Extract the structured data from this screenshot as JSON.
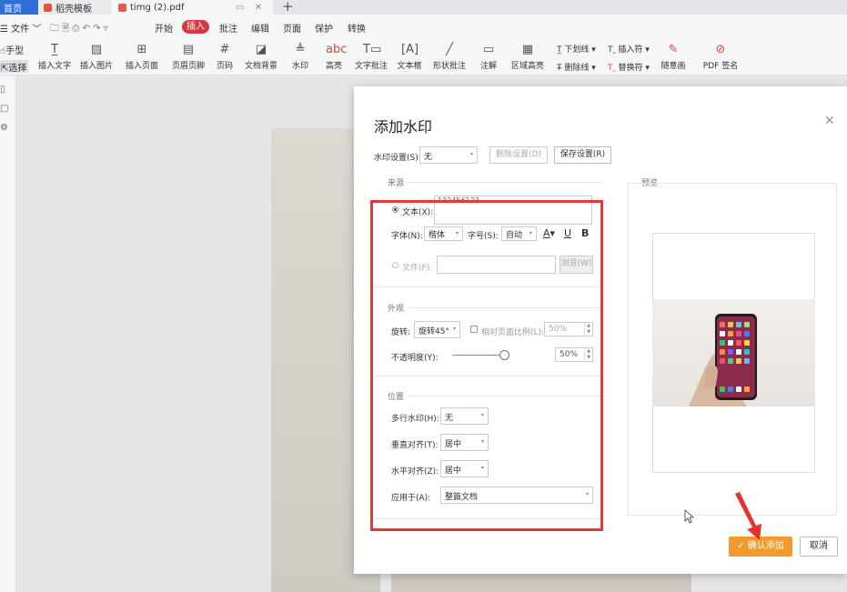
{
  "tabs": [
    {
      "label": "首页"
    },
    {
      "label": "稻壳模板"
    },
    {
      "label": "timg (2).pdf"
    }
  ],
  "menu": {
    "file": "文件",
    "items": [
      "开始",
      "插入",
      "批注",
      "编辑",
      "页面",
      "保护",
      "转换"
    ],
    "active": "插入"
  },
  "toolbar": {
    "hand": "手型",
    "select": "选择",
    "buttons": [
      "插入文字",
      "插入图片",
      "插入页面",
      "页眉页脚",
      "页码",
      "文档背景",
      "水印",
      "高亮",
      "文字批注",
      "文本框",
      "形状批注",
      "注解",
      "区域高亮"
    ],
    "right_top": [
      "下划线",
      "插入符"
    ],
    "right_bottom": [
      "删除线",
      "替换符"
    ],
    "freehand": "随意画",
    "pdf_sign": "PDF 签名"
  },
  "dialog": {
    "title": "添加水印",
    "preset_label": "水印设置(S):",
    "preset_value": "无",
    "delete_btn": "删除设置(D)",
    "save_btn": "保存设置(R)",
    "source_section": "来源",
    "text_radio": "文本(X):",
    "text_value": "132456123",
    "font_label": "字体(N):",
    "font_value": "楷体",
    "size_label": "字号(S):",
    "size_value": "自动",
    "file_radio": "文件(F):",
    "browse_btn": "浏览(W)",
    "appearance_section": "外观",
    "rotate_label": "旋转:",
    "rotate_value": "旋转45°",
    "relative_label": "相对页面比例(L):",
    "relative_value": "50%",
    "opacity_label": "不透明度(Y):",
    "opacity_value": "50%",
    "position_section": "位置",
    "multiline_label": "多行水印(H):",
    "multiline_value": "无",
    "valign_label": "垂直对齐(T):",
    "valign_value": "居中",
    "halign_label": "水平对齐(Z):",
    "halign_value": "居中",
    "apply_label": "应用于(A):",
    "apply_value": "整篇文档",
    "preview_label": "预览",
    "confirm_btn": "确认添加",
    "cancel_btn": "取消"
  },
  "colors": {
    "home_tab": "#2f6fd8",
    "insert_active": "#d7373f",
    "highlight": "#e03b3b",
    "confirm": "#f29a2e"
  }
}
